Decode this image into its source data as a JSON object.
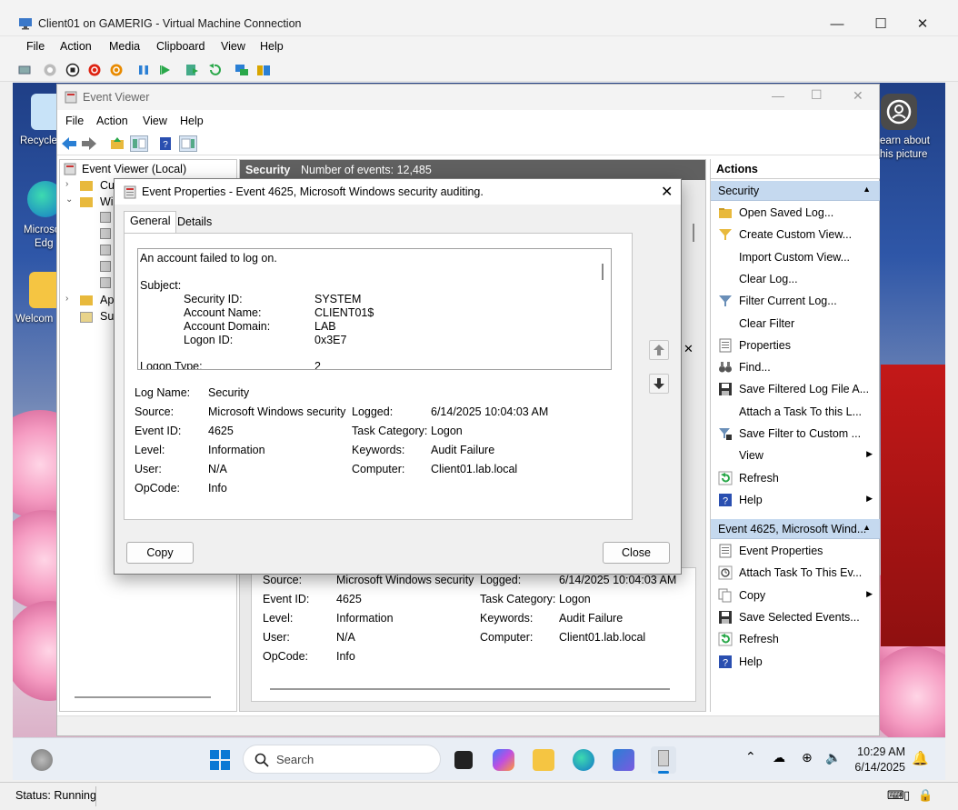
{
  "vm": {
    "title": "Client01 on GAMERIG - Virtual Machine Connection",
    "menu": [
      "File",
      "Action",
      "Media",
      "Clipboard",
      "View",
      "Help"
    ],
    "status": "Status: Running"
  },
  "desktop": {
    "icons": [
      {
        "label": "Recycle",
        "icon": "recycle-bin-icon"
      },
      {
        "label": "Microso",
        "label2": "Edg",
        "icon": "edge-icon"
      },
      {
        "label": "Welcom",
        "icon": "folder-icon"
      },
      {
        "label": "earn about",
        "label2": "his picture",
        "icon": "learn-about-picture-icon"
      }
    ]
  },
  "taskbar": {
    "search_placeholder": "Search",
    "time": "10:29 AM",
    "date": "6/14/2025"
  },
  "event_viewer": {
    "title": "Event Viewer",
    "menu": [
      "File",
      "Action",
      "View",
      "Help"
    ],
    "tree": {
      "root": "Event Viewer (Local)",
      "items": [
        "Cus",
        "Win",
        "App",
        "Sub"
      ]
    },
    "center_header": {
      "name": "Security",
      "count": "Number of events: 12,485"
    },
    "actions_title": "Actions",
    "security_section": "Security",
    "security_actions": [
      {
        "label": "Open Saved Log...",
        "icon": "open-folder-icon"
      },
      {
        "label": "Create Custom View...",
        "icon": "filter-funnel-icon"
      },
      {
        "label": "Import Custom View...",
        "icon": ""
      },
      {
        "label": "Clear Log...",
        "icon": ""
      },
      {
        "label": "Filter Current Log...",
        "icon": "filter-icon"
      },
      {
        "label": "Clear Filter",
        "icon": ""
      },
      {
        "label": "Properties",
        "icon": "properties-icon"
      },
      {
        "label": "Find...",
        "icon": "binoculars-icon"
      },
      {
        "label": "Save Filtered Log File A...",
        "icon": "save-icon"
      },
      {
        "label": "Attach a Task To this L...",
        "icon": ""
      },
      {
        "label": "Save Filter to Custom ...",
        "icon": "save-filter-icon"
      },
      {
        "label": "View",
        "icon": "",
        "submenu": true
      },
      {
        "label": "Refresh",
        "icon": "refresh-icon"
      },
      {
        "label": "Help",
        "icon": "help-icon",
        "submenu": true
      }
    ],
    "event_section": "Event 4625, Microsoft Wind...",
    "event_actions": [
      {
        "label": "Event Properties",
        "icon": "event-properties-icon"
      },
      {
        "label": "Attach Task To This Ev...",
        "icon": "attach-task-icon"
      },
      {
        "label": "Copy",
        "icon": "copy-icon",
        "submenu": true
      },
      {
        "label": "Save Selected Events...",
        "icon": "save-icon"
      },
      {
        "label": "Refresh",
        "icon": "refresh-icon"
      },
      {
        "label": "Help",
        "icon": "help-icon"
      }
    ]
  },
  "dialog": {
    "title": "Event Properties - Event 4625, Microsoft Windows security auditing.",
    "tabs": [
      "General",
      "Details"
    ],
    "description": {
      "headline": "An account failed to log on.",
      "subject_label": "Subject:",
      "fields": [
        {
          "k": "Security ID:",
          "v": "SYSTEM"
        },
        {
          "k": "Account Name:",
          "v": "CLIENT01$"
        },
        {
          "k": "Account Domain:",
          "v": "LAB"
        },
        {
          "k": "Logon ID:",
          "v": "0x3E7"
        }
      ],
      "logon_type_label": "Logon Type:",
      "logon_type_value": "2"
    },
    "props": {
      "log_name_label": "Log Name:",
      "log_name": "Security",
      "source_label": "Source:",
      "source": "Microsoft Windows security",
      "logged_label": "Logged:",
      "logged": "6/14/2025 10:04:03 AM",
      "event_id_label": "Event ID:",
      "event_id": "4625",
      "task_category_label": "Task Category:",
      "task_category": "Logon",
      "level_label": "Level:",
      "level": "Information",
      "keywords_label": "Keywords:",
      "keywords": "Audit Failure",
      "user_label": "User:",
      "user": "N/A",
      "computer_label": "Computer:",
      "computer": "Client01.lab.local",
      "opcode_label": "OpCode:",
      "opcode": "Info"
    },
    "copy_button": "Copy",
    "close_button": "Close"
  }
}
